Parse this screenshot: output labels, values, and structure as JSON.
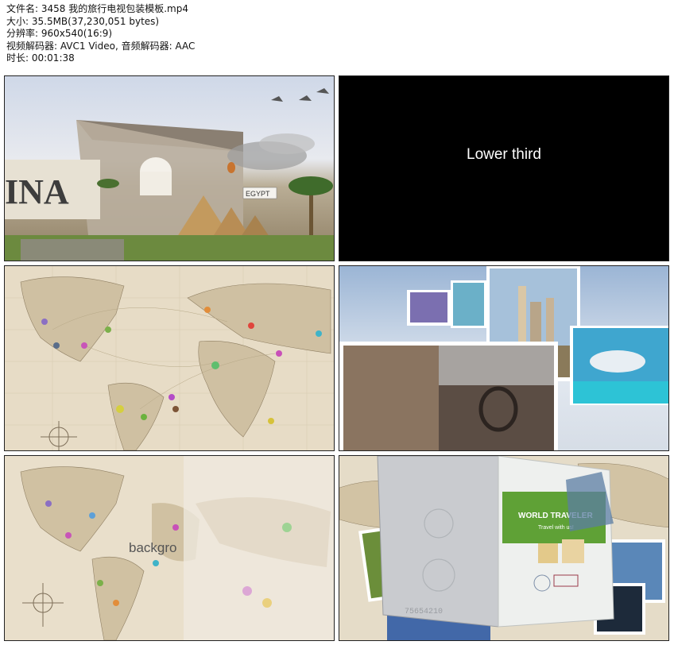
{
  "info": {
    "filename": "文件名: 3458 我的旅行电视包装模板.mp4",
    "size": "大小: 35.5MB(37,230,051 bytes)",
    "resolution": "分辨率: 960x540(16:9)",
    "codec": "视频解码器: AVC1 Video, 音频解码器: AAC",
    "duration": "时长: 00:01:38"
  },
  "frames": {
    "f1": {
      "big_word": "INA",
      "sign": "EGYPT"
    },
    "f2": {
      "caption": "Lower third"
    },
    "f5": {
      "caption": "backgro"
    },
    "f6": {
      "card_title": "WORLD TRAVELER",
      "card_sub": "Travel with us!",
      "passport_num": "75654210"
    }
  }
}
